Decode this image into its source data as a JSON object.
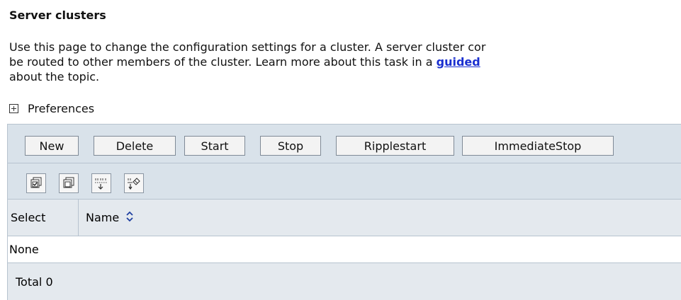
{
  "page": {
    "title": "Server clusters",
    "description": {
      "line1": "Use this page to change the configuration settings for a cluster. A server cluster cor",
      "line2_prefix": "be routed to other members of the cluster. Learn more about this task in a ",
      "line2_link": "guided",
      "line3": "about the topic."
    },
    "preferences_label": "Preferences"
  },
  "toolbar": {
    "buttons": {
      "new": "New",
      "delete": "Delete",
      "start": "Start",
      "stop": "Stop",
      "ripplestart": "Ripplestart",
      "immediatestop": "ImmediateStop"
    },
    "icons": [
      "select-all-icon",
      "deselect-all-icon",
      "show-filter-icon",
      "clear-filter-icon"
    ]
  },
  "table": {
    "columns": {
      "select": "Select",
      "name": "Name"
    },
    "empty_text": "None",
    "total": "Total 0"
  },
  "colors": {
    "toolbar_bg": "#d9e2ea",
    "header_bg": "#e4e9ee",
    "border": "#b7c3cf",
    "link": "#1a2fd0"
  }
}
